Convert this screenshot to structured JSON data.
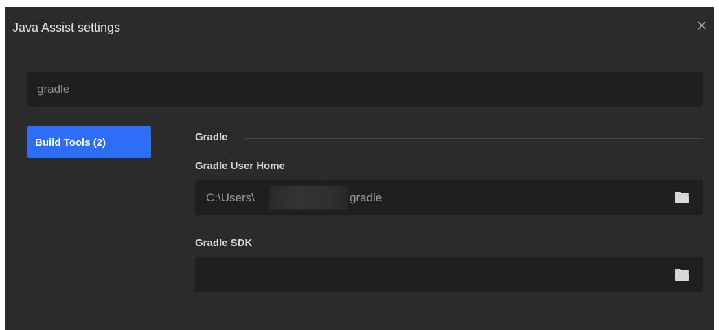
{
  "window": {
    "title": "Java Assist settings"
  },
  "search": {
    "value": "gradle"
  },
  "categories": [
    {
      "label": "Build Tools  (2)"
    }
  ],
  "section": {
    "title": "Gradle"
  },
  "fields": [
    {
      "label": "Gradle User Home",
      "value_prefix": "C:\\Users\\",
      "value_suffix": "gradle"
    },
    {
      "label": "Gradle SDK",
      "value_prefix": "",
      "value_suffix": ""
    }
  ],
  "icons": {
    "close": "close-icon",
    "browse": "folder-icon"
  },
  "colors": {
    "accent": "#2e6df6",
    "background": "#2b2b2d",
    "field_background": "#1f1f21"
  }
}
